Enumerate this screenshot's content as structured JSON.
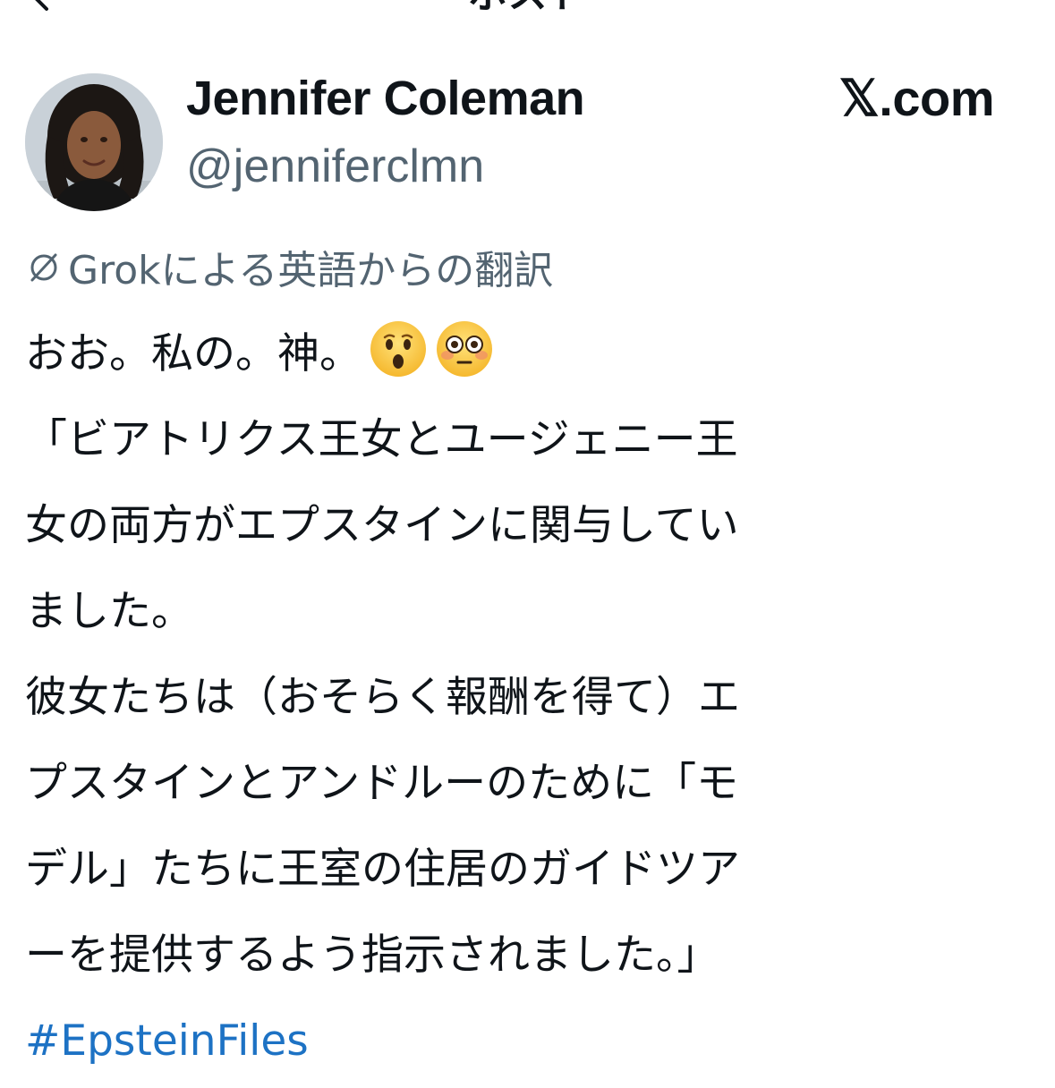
{
  "header": {
    "title": "ポスト"
  },
  "post": {
    "author_name": "Jennifer Coleman",
    "author_handle": "@jenniferclmn",
    "source_label": "𝕏.com",
    "translation_note": "Grokによる英語からの翻訳",
    "body_lines": [
      "おお。私の。神。",
      "「ビアトリクス王女とユージェニー王",
      "女の両方がエプスタインに関与してい",
      "ました。",
      "彼女たちは（おそらく報酬を得て）エ",
      "プスタインとアンドルーのために「モ",
      "デル」たちに王室の住居のガイドツア",
      "ーを提供するよう指示されました。」"
    ],
    "emojis": [
      "hushed-face-emoji",
      "flushed-face-emoji"
    ],
    "hashtag": "#EpsteinFiles"
  },
  "colors": {
    "text": "#0f1419",
    "secondary": "#536471",
    "link": "#1d72c4"
  }
}
